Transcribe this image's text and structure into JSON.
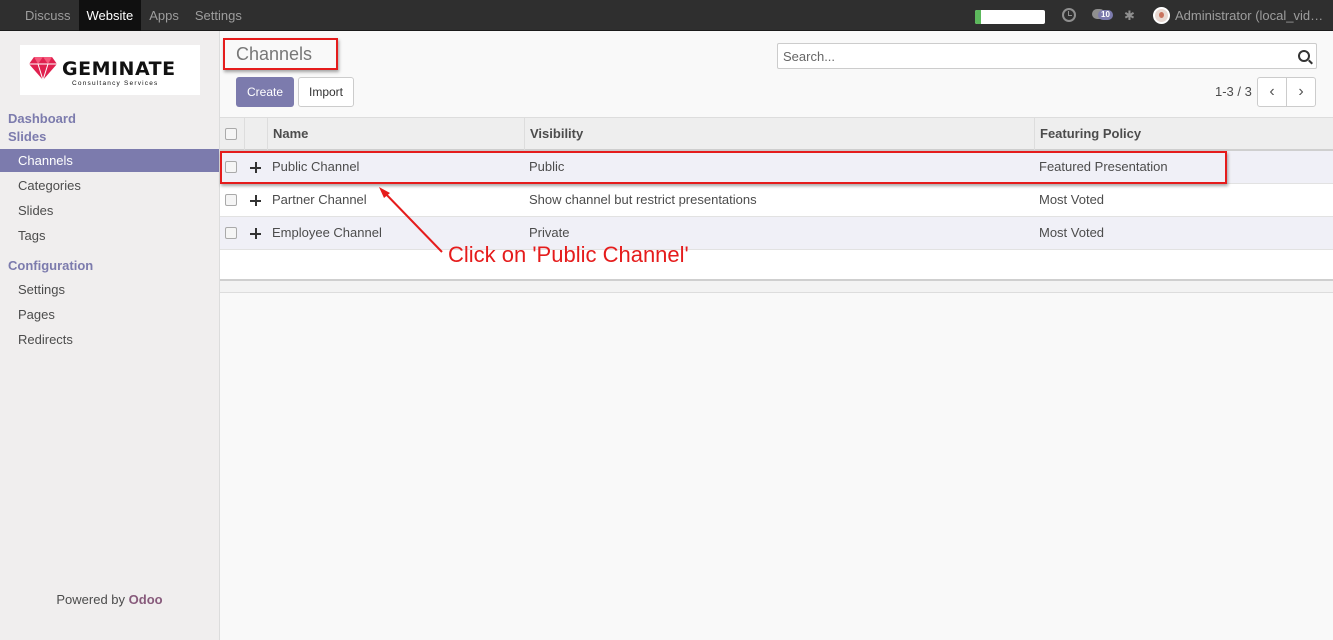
{
  "topbar": {
    "menu": [
      "Discuss",
      "Website",
      "Apps",
      "Settings"
    ],
    "active_menu": "Website",
    "progress_fraction": 0.08,
    "chat_badge": "10",
    "user_name": "Administrator (local_vid…"
  },
  "sidebar": {
    "logo": {
      "brand": "GEMINATE",
      "tagline": "Consultancy Services"
    },
    "dashboard_label": "Dashboard",
    "slides_label": "Slides",
    "slides_items": [
      "Channels",
      "Categories",
      "Slides",
      "Tags"
    ],
    "configuration_label": "Configuration",
    "config_items": [
      "Settings",
      "Pages",
      "Redirects"
    ],
    "powered_prefix": "Powered by ",
    "powered_brand": "Odoo"
  },
  "control": {
    "title": "Channels",
    "create_label": "Create",
    "import_label": "Import",
    "search_placeholder": "Search...",
    "pager_text": "1-3 / 3",
    "prev_glyph": "‹",
    "next_glyph": "›"
  },
  "table": {
    "columns": [
      "Name",
      "Visibility",
      "Featuring Policy"
    ],
    "rows": [
      {
        "name": "Public Channel",
        "visibility": "Public",
        "featuring": "Featured Presentation"
      },
      {
        "name": "Partner Channel",
        "visibility": "Show channel but restrict presentations",
        "featuring": "Most Voted"
      },
      {
        "name": "Employee Channel",
        "visibility": "Private",
        "featuring": "Most Voted"
      }
    ]
  },
  "annotation": {
    "text": "Click on 'Public Channel'",
    "color": "#e51c1c"
  },
  "colors": {
    "accent": "#7c7bad",
    "topbar": "#2f2f2f",
    "brand": "#875a7b"
  }
}
